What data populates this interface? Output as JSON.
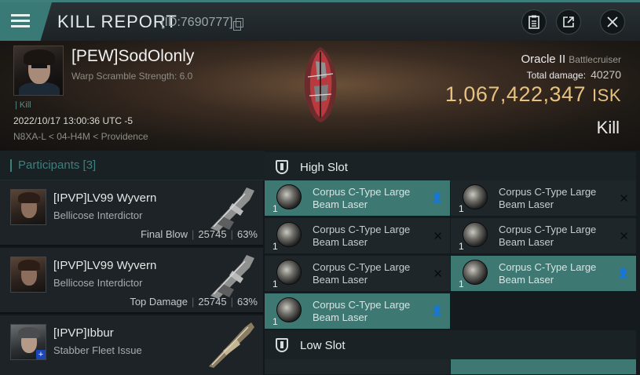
{
  "window": {
    "title": "KILL REPORT",
    "report_id": "[ID:7690777]"
  },
  "toolbar": {
    "notes_icon": "clipboard-icon",
    "share_icon": "external-link-icon",
    "close_icon": "close-icon"
  },
  "victim": {
    "name": "[PEW]SodOlonly",
    "subtitle": "Warp Scramble Strength: 6.0",
    "kill_tag": "Kill",
    "date": "2022/10/17 13:00:36 UTC -5",
    "location": "N8XA-L < 04-H4M < Providence"
  },
  "ship": {
    "name": "Oracle II",
    "class": "Battlecruiser",
    "total_damage_label": "Total damage:",
    "total_damage": "40270",
    "isk_value": "1,067,422,347",
    "isk_unit": "ISK",
    "result": "Kill"
  },
  "participants": {
    "header": "Participants [3]",
    "rows": [
      {
        "name": "[IPVP]LV99 Wyvern",
        "ship": "Bellicose Interdictor",
        "role": "Final Blow",
        "damage": "25745",
        "percent": "63%"
      },
      {
        "name": "[IPVP]LV99 Wyvern",
        "ship": "Bellicose Interdictor",
        "role": "Top Damage",
        "damage": "25745",
        "percent": "63%"
      },
      {
        "name": "[IPVP]Ibbur",
        "ship": "Stabber Fleet Issue",
        "role": "",
        "damage": "",
        "percent": ""
      }
    ]
  },
  "fitting": {
    "high_slot_title": "High Slot",
    "low_slot_title": "Low Slot",
    "modules": [
      {
        "qty": "1",
        "name": "Corpus C-Type Large Beam Laser",
        "state": "pilot-icon",
        "highlight": true
      },
      {
        "qty": "1",
        "name": "Corpus C-Type Large Beam Laser",
        "state": "x-icon",
        "highlight": false
      },
      {
        "qty": "1",
        "name": "Corpus C-Type Large Beam Laser",
        "state": "x-icon",
        "highlight": false
      },
      {
        "qty": "1",
        "name": "Corpus C-Type Large Beam Laser",
        "state": "x-icon",
        "highlight": false
      },
      {
        "qty": "1",
        "name": "Corpus C-Type Large Beam Laser",
        "state": "x-icon",
        "highlight": false
      },
      {
        "qty": "1",
        "name": "Corpus C-Type Large Beam Laser",
        "state": "pilot-icon",
        "highlight": true
      },
      {
        "qty": "1",
        "name": "Corpus C-Type Large Beam Laser",
        "state": "pilot-icon",
        "highlight": true
      }
    ]
  },
  "colors": {
    "accent_teal": "#3e7f7c",
    "isk_gold": "#e6c17f",
    "highlight_row": "#3e7873"
  }
}
